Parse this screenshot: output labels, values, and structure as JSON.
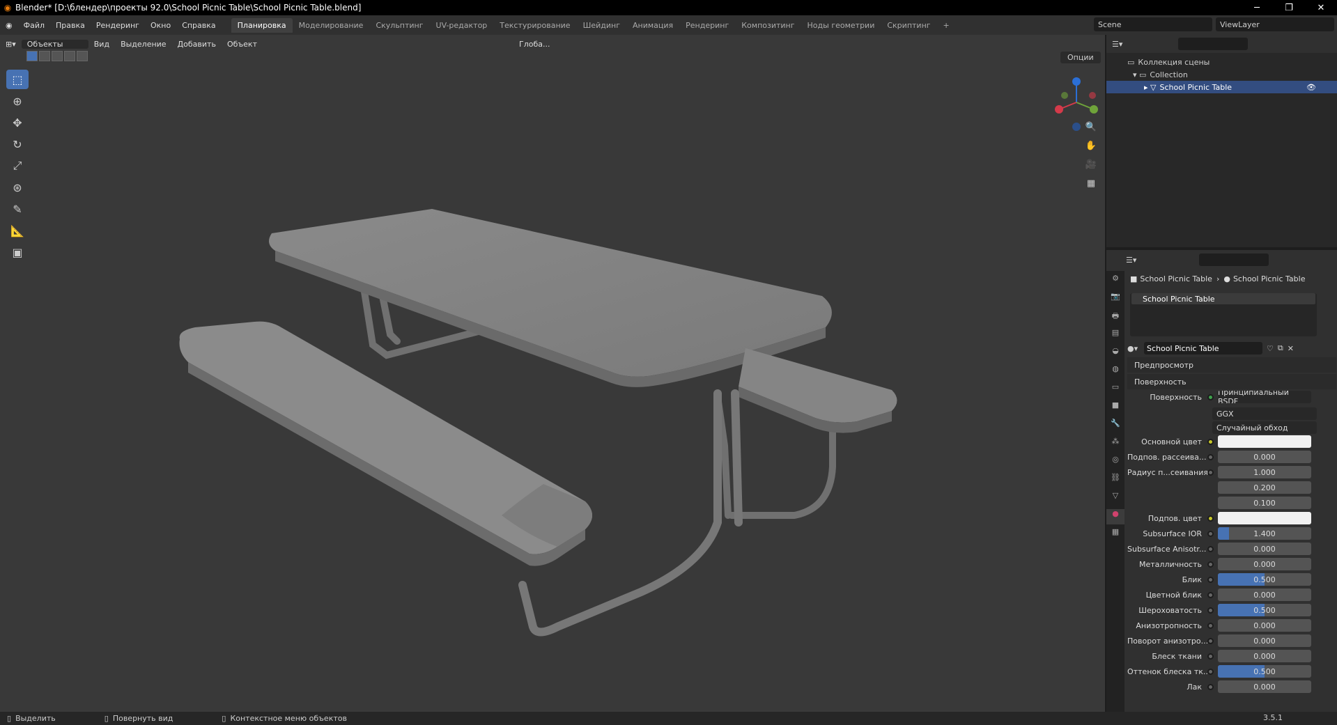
{
  "title": "Blender* [D:\\блендер\\проекты 92.0\\School Picnic Table\\School Picnic Table.blend]",
  "menu": [
    "Файл",
    "Правка",
    "Рендеринг",
    "Окно",
    "Справка"
  ],
  "workspaces": [
    "Планировка",
    "Моделирование",
    "Скульптинг",
    "UV-редактор",
    "Текстурирование",
    "Шейдинг",
    "Анимация",
    "Рендеринг",
    "Композитинг",
    "Ноды геометрии",
    "Скриптинг",
    "+"
  ],
  "scene": "Scene",
  "view_layer": "ViewLayer",
  "viewport": {
    "mode": "Объекты",
    "menus": [
      "Вид",
      "Выделение",
      "Добавить",
      "Объект"
    ],
    "orientation": "Глоба...",
    "options": "Опции"
  },
  "outliner": {
    "scene_collection": "Коллекция сцены",
    "collection": "Collection",
    "object": "School Picnic Table"
  },
  "properties": {
    "breadcrumb_obj": "School Picnic Table",
    "breadcrumb_mat": "School Picnic Table",
    "slot": "School Picnic Table",
    "material": "School Picnic Table",
    "preview": "Предпросмотр",
    "surface_panel": "Поверхность",
    "surface_label": "Поверхность",
    "surface_value": "Принципиальный BSDF",
    "distribution": "GGX",
    "subsurface_method": "Случайный обход",
    "rows": [
      {
        "label": "Основной цвет",
        "type": "color"
      },
      {
        "label": "Подпов. рассеива...",
        "value": "0.000",
        "fill": 0
      },
      {
        "label": "Радиус п...сеивания",
        "value": "1.000",
        "fill": 0
      },
      {
        "label": "",
        "value": "0.200",
        "fill": 0
      },
      {
        "label": "",
        "value": "0.100",
        "fill": 0
      },
      {
        "label": "Подпов. цвет",
        "type": "color"
      },
      {
        "label": "Subsurface IOR",
        "value": "1.400",
        "fill": 0.12
      },
      {
        "label": "Subsurface Anisotr...",
        "value": "0.000",
        "fill": 0
      },
      {
        "label": "Металличность",
        "value": "0.000",
        "fill": 0
      },
      {
        "label": "Блик",
        "value": "0.500",
        "fill": 0.5
      },
      {
        "label": "Цветной блик",
        "value": "0.000",
        "fill": 0
      },
      {
        "label": "Шероховатость",
        "value": "0.500",
        "fill": 0.5
      },
      {
        "label": "Анизотропность",
        "value": "0.000",
        "fill": 0
      },
      {
        "label": "Поворот анизотро...",
        "value": "0.000",
        "fill": 0
      },
      {
        "label": "Блеск ткани",
        "value": "0.000",
        "fill": 0
      },
      {
        "label": "Оттенок блеска тк...",
        "value": "0.500",
        "fill": 0.5
      },
      {
        "label": "Лак",
        "value": "0.000",
        "fill": 0
      }
    ]
  },
  "status": [
    "Выделить",
    "Повернуть вид",
    "Контекстное меню объектов"
  ],
  "version": "3.5.1"
}
